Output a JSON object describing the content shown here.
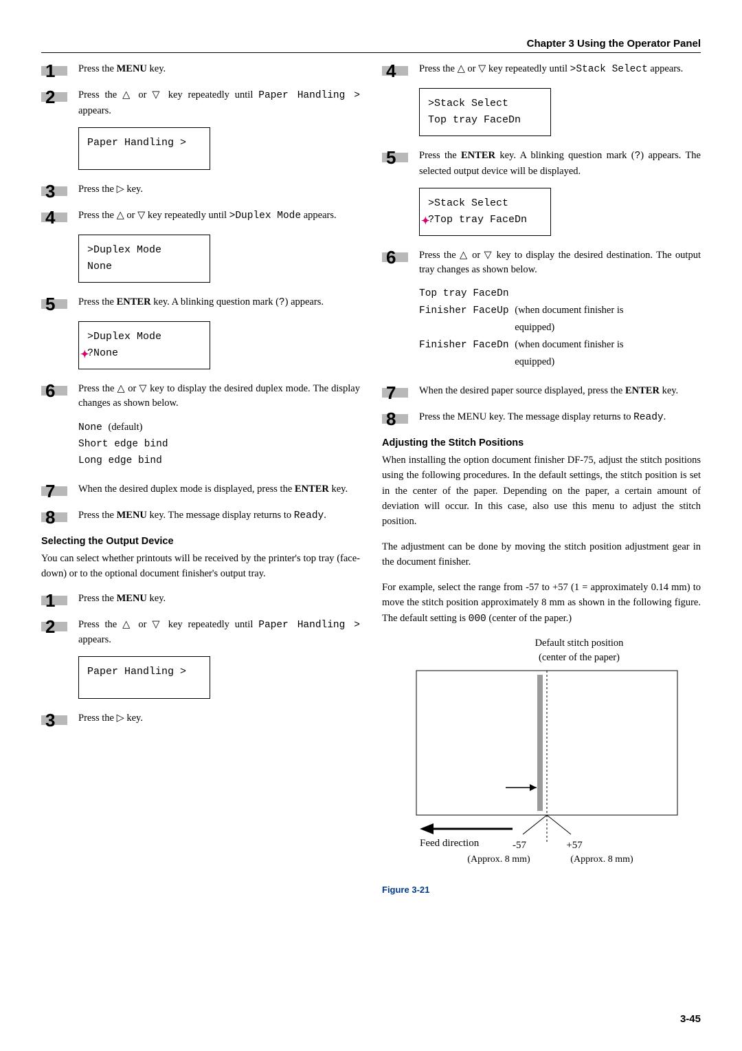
{
  "header": "Chapter 3  Using the Operator Panel",
  "page_number": "3-45",
  "left": {
    "steps": [
      {
        "n": "1",
        "html": "Press the <b>MENU</b> key."
      },
      {
        "n": "2",
        "html": "Press the <span class='tri'>△</span> or <span class='tri'>▽</span> key repeatedly until <span class='mono'>Paper Handling &gt;</span> appears."
      },
      {
        "display": [
          "Paper Handling >"
        ],
        "pad": true
      },
      {
        "n": "3",
        "html": "Press the <span class='tri'>▷</span> key."
      },
      {
        "n": "4",
        "html": "Press the <span class='tri'>△</span> or <span class='tri'>▽</span> key repeatedly until <span class='mono'>&gt;Duplex Mode</span> appears."
      },
      {
        "display": [
          ">Duplex Mode",
          " None"
        ],
        "pad": false
      },
      {
        "n": "5",
        "html": "Press the <b>ENTER</b> key. A blinking question mark (<span class='mono'>?</span>) appears."
      },
      {
        "display_blink": [
          ">Duplex Mode",
          "?None"
        ]
      },
      {
        "n": "6",
        "html": "Press the <span class='tri'>△</span> or <span class='tri'>▽</span> key to display the desired duplex mode. The display changes as shown below."
      },
      {
        "indent_html": "<span class='mono'>None</span> <span class='annot'>(default)</span><br><span class='mono'>Short edge bind</span><br><span class='mono'>Long edge bind</span>"
      },
      {
        "n": "7",
        "html": "When the desired duplex mode is displayed, press the <b>ENTER</b> key."
      },
      {
        "n": "8",
        "html": "Press the <b>MENU</b> key. The message display returns to <span class='mono'>Ready</span>."
      }
    ],
    "section_head": "Selecting the Output Device",
    "section_para": "You can select whether printouts will be received by the printer's top tray (face-down) or to the optional document finisher's output tray.",
    "steps2": [
      {
        "n": "1",
        "html": "Press the <b>MENU</b> key."
      },
      {
        "n": "2",
        "html": "Press the <span class='tri'>△</span> or <span class='tri'>▽</span> key repeatedly until <span class='mono'>Paper Handling &gt;</span> appears."
      },
      {
        "display": [
          "Paper Handling >"
        ],
        "pad": true
      },
      {
        "n": "3",
        "html": "Press the <span class='tri'>▷</span> key."
      }
    ]
  },
  "right": {
    "steps": [
      {
        "n": "4",
        "html": "Press the <span class='tri'>△</span> or <span class='tri'>▽</span> key repeatedly until <span class='mono'>&gt;Stack Select</span> appears."
      },
      {
        "display": [
          ">Stack Select",
          " Top tray FaceDn"
        ],
        "pad": false
      },
      {
        "n": "5",
        "html": "Press the <b>ENTER</b> key. A blinking question mark (<span class='mono'>?</span>) appears. The selected output device will be displayed."
      },
      {
        "display_blink": [
          ">Stack Select",
          "?Top tray FaceDn"
        ]
      },
      {
        "n": "6",
        "html": "Press the <span class='tri'>△</span> or <span class='tri'>▽</span> key to display the desired destination. The output tray changes as shown below."
      },
      {
        "indent_html": "<span class='mono'>Top tray FaceDn</span><br><span class='mono'>Finisher FaceUp</span> <span class='annot'>(when document finisher is</span><br><span style='visibility:hidden' class='mono'>Finisher FaceUp </span><span class='annot'>equipped)</span><br><span class='mono'>Finisher FaceDn</span> <span class='annot'>(when document finisher is</span><br><span style='visibility:hidden' class='mono'>Finisher FaceDn </span><span class='annot'>equipped)</span>"
      },
      {
        "n": "7",
        "html": "When the desired paper source displayed, press the <b>ENTER</b> key."
      },
      {
        "n": "8",
        "html": "Press the MENU key. The message display returns to <span class='mono'>Ready</span>."
      }
    ],
    "section_head": "Adjusting the Stitch Positions",
    "para1": "When installing the option document finisher DF-75, adjust the stitch positions using the following procedures. In the default settings, the stitch position is set in the center of the paper. Depending on the paper, a certain amount of deviation will occur. In this case, also use this menu to adjust the stitch position.",
    "para2": "The adjustment can be done by moving the stitch position adjustment gear in the document finisher.",
    "para3_html": "For example, select the range from -57 to +57 (1 = approximately 0.14 mm) to move the stitch position approximately 8 mm as shown in the following figure. The default setting is <span class='mono'>000</span> (center of the paper.)",
    "fig_top1": "Default stitch position",
    "fig_top2": "(center of the paper)",
    "fig_feed": "Feed direction",
    "fig_minus": "-57",
    "fig_plus": "+57",
    "fig_approx_l": "(Approx. 8 mm)",
    "fig_approx_r": "(Approx. 8 mm)",
    "fig_caption": "Figure 3-21"
  }
}
